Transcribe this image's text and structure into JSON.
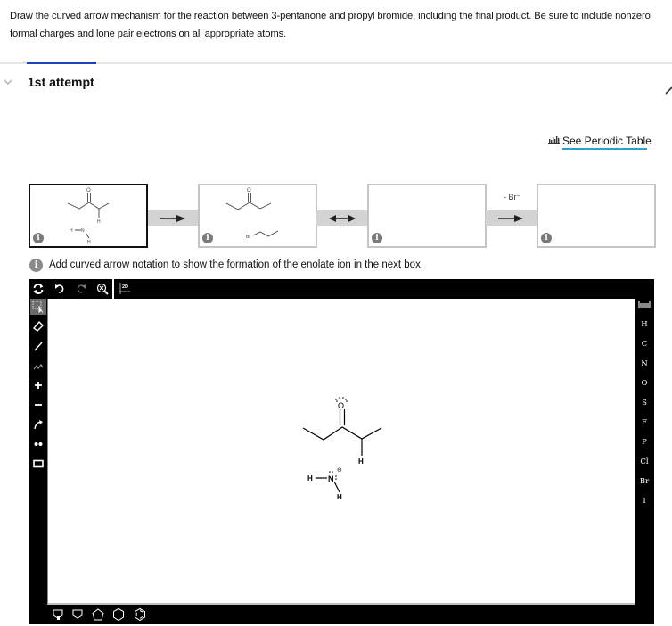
{
  "question": {
    "text": "Draw the curved arrow mechanism for the reaction between 3-pentanone and propyl bromide, including the final product. Be sure to include nonzero formal charges and lone pair electrons on all appropriate atoms."
  },
  "attempt": {
    "title": "1st attempt",
    "collapse_icon": "chevron-down-icon",
    "edit_icon": "pencil-icon"
  },
  "periodic_table": {
    "label": "See Periodic Table",
    "icon": "periodic-table-icon"
  },
  "steps": [
    {
      "name": "step-1",
      "active": true,
      "info_icon": "i",
      "molecules": [
        "3-pentanone with lone pairs on O and alpha H",
        "amide anion H-N(-)-H"
      ]
    },
    {
      "name": "step-2",
      "active": false,
      "info_icon": "i",
      "molecules": [
        "enolate carbanion",
        "propyl bromide"
      ]
    },
    {
      "name": "step-3",
      "active": false,
      "info_icon": "i",
      "molecules": []
    },
    {
      "name": "step-4",
      "active": false,
      "info_icon": "i",
      "molecules": []
    }
  ],
  "connectors": [
    {
      "type": "forward-arrow",
      "label": ""
    },
    {
      "type": "resonance-arrow",
      "label": ""
    },
    {
      "type": "forward-arrow",
      "label": "- Br⁻"
    }
  ],
  "hint": {
    "icon": "i",
    "text": "Add curved arrow notation to show the formation of the enolate ion in the next box."
  },
  "editor": {
    "top_toolbar": [
      {
        "name": "refresh-icon",
        "label": "Clear"
      },
      {
        "name": "undo-icon",
        "label": "Undo"
      },
      {
        "name": "redo-icon",
        "label": "Redo"
      },
      {
        "name": "zoom-reset-icon",
        "label": "Zoom"
      },
      {
        "name": "clean-2d-icon",
        "label": "2D"
      }
    ],
    "clean_label": "2D",
    "left_toolbar": [
      {
        "name": "select-tool-icon",
        "selected": true
      },
      {
        "name": "eraser-icon",
        "selected": false
      },
      {
        "name": "single-bond-icon",
        "selected": false
      },
      {
        "name": "chain-icon",
        "selected": false
      },
      {
        "name": "positive-charge-icon",
        "selected": false
      },
      {
        "name": "negative-charge-icon",
        "selected": false
      },
      {
        "name": "curved-arrow-icon",
        "selected": false
      },
      {
        "name": "lone-pair-icon",
        "selected": false
      },
      {
        "name": "rectangle-icon",
        "selected": false
      }
    ],
    "elements": [
      "H",
      "C",
      "N",
      "O",
      "S",
      "F",
      "P",
      "Cl",
      "Br",
      "I"
    ],
    "bottom_toolbar": [
      {
        "name": "custom-template-icon"
      },
      {
        "name": "cyclobutane-icon"
      },
      {
        "name": "cyclopentane-icon"
      },
      {
        "name": "cyclohexane-icon"
      },
      {
        "name": "benzene-icon"
      }
    ],
    "canvas": {
      "atoms": {
        "oxygen": "O",
        "alpha_hydrogen": "H",
        "nitrogen": "N",
        "nh_left": "H",
        "nh_bottom": "H",
        "n_charge": "⊖"
      }
    }
  }
}
